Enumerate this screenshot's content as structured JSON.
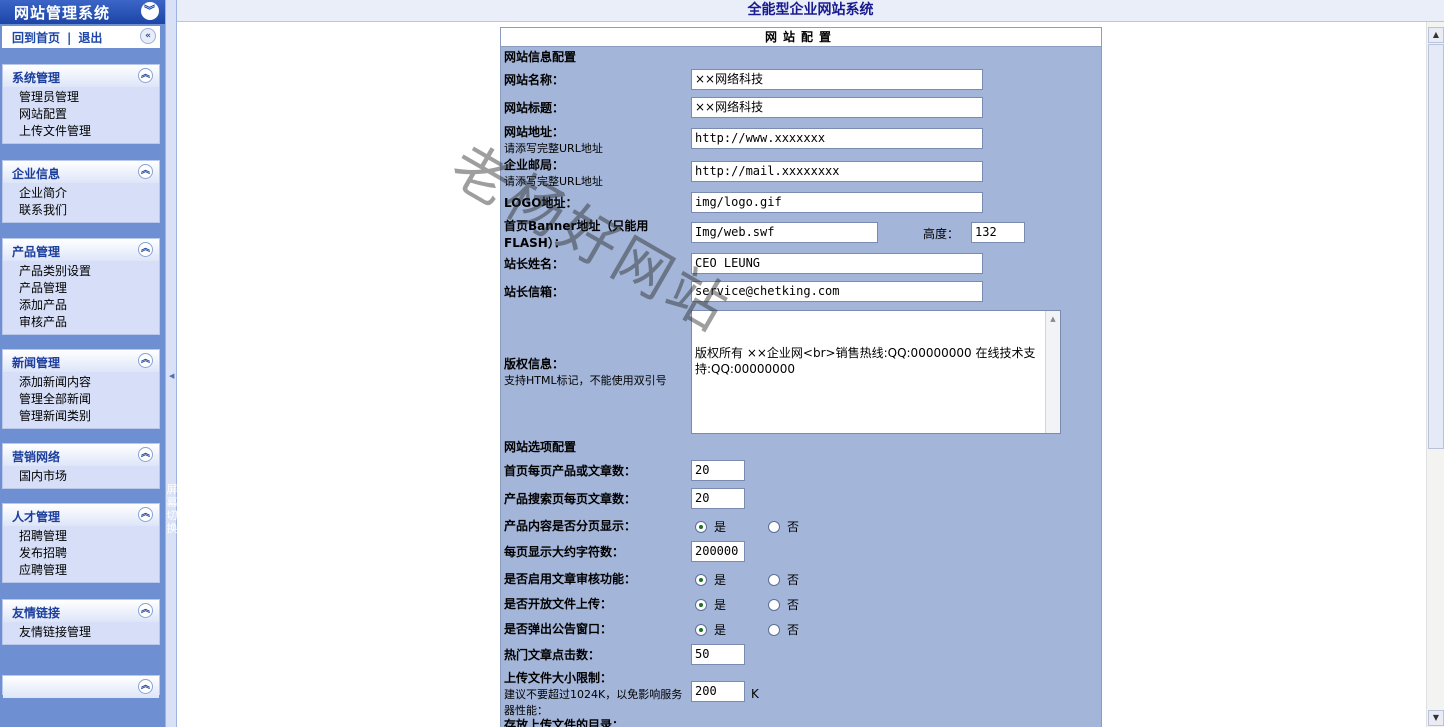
{
  "sidebar": {
    "brand": "网站管理系统",
    "home_link": "回到首页",
    "separator": "|",
    "logout_link": "退出",
    "menus": [
      {
        "title": "系统管理",
        "items": [
          "管理员管理",
          "网站配置",
          "上传文件管理"
        ]
      },
      {
        "title": "企业信息",
        "items": [
          "企业简介",
          "联系我们"
        ]
      },
      {
        "title": "产品管理",
        "items": [
          "产品类别设置",
          "产品管理",
          "添加产品",
          "审核产品"
        ]
      },
      {
        "title": "新闻管理",
        "items": [
          "添加新闻内容",
          "管理全部新闻",
          "管理新闻类别"
        ]
      },
      {
        "title": "营销网络",
        "items": [
          "国内市场"
        ]
      },
      {
        "title": "人才管理",
        "items": [
          "招聘管理",
          "发布招聘",
          "应聘管理"
        ]
      },
      {
        "title": "友情链接",
        "items": [
          "友情链接管理"
        ]
      }
    ]
  },
  "splitter": {
    "label": "屏幕切换"
  },
  "header": {
    "title": "全能型企业网站系统"
  },
  "panel": {
    "title": "网站配置",
    "section_info": "网站信息配置",
    "site_name_label": "网站名称：",
    "site_name_value": "××网络科技",
    "site_title_label": "网站标题：",
    "site_title_value": "××网络科技",
    "site_url_label": "网站地址：",
    "site_url_hint": "请添写完整URL地址",
    "site_url_value": "http://www.xxxxxxx",
    "mail_label": "企业邮局：",
    "mail_hint": "请添写完整URL地址",
    "mail_value": "http://mail.xxxxxxxx",
    "logo_label": "LOGO地址：",
    "logo_value": "img/logo.gif",
    "banner_label": "首页Banner地址（只能用FLASH）：",
    "banner_value": "Img/web.swf",
    "height_label": "高度：",
    "height_value": "132",
    "owner_label": "站长姓名：",
    "owner_value": "CEO LEUNG",
    "owner_mail_label": "站长信箱：",
    "owner_mail_value": "service@chetking.com",
    "copyright_label": "版权信息：",
    "copyright_hint": "支持HTML标记，不能使用双引号",
    "copyright_value": "版权所有 ××企业网<br>销售热线:QQ:00000000 在线技术支持:QQ:00000000",
    "section_options": "网站选项配置",
    "home_count_label": "首页每页产品或文章数：",
    "home_count_value": "20",
    "search_count_label": "产品搜索页每页文章数：",
    "search_count_value": "20",
    "paging_label": "产品内容是否分页显示：",
    "chars_label": "每页显示大约字符数：",
    "chars_value": "200000",
    "audit_label": "是否启用文章审核功能：",
    "upload_label": "是否开放文件上传：",
    "popup_label": "是否弹出公告窗口：",
    "hot_label": "热门文章点击数：",
    "hot_value": "50",
    "upload_limit_label": "上传文件大小限制：",
    "upload_limit_hint": "建议不要超过1024K，以免影响服务器性能：",
    "upload_limit_value": "200",
    "upload_limit_unit": "K",
    "upload_dir_label": "存放上传文件的目录：",
    "yes": "是",
    "no": "否"
  },
  "watermark": "老杨好网站"
}
